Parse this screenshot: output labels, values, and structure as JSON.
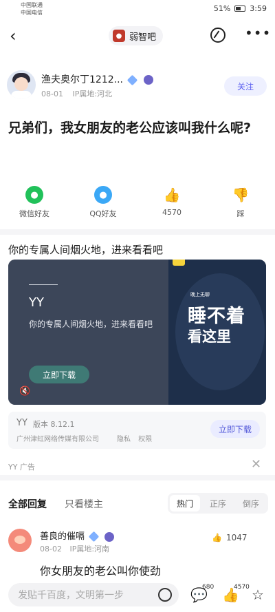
{
  "status_bar": {
    "carrier1": "中国联通",
    "carrier2": "中国电信",
    "battery": "51%",
    "time": "3:59"
  },
  "nav": {
    "forum_name": "弱智吧"
  },
  "author": {
    "name": "渔夫奥尔丁1212...",
    "date": "08-01",
    "ip": "IP属地:河北",
    "follow_label": "关注"
  },
  "post": {
    "title": "兄弟们，我女朋友的老公应该叫我什么呢?"
  },
  "share": {
    "wechat": "微信好友",
    "qq": "QQ好友",
    "like_count": "4570",
    "dislike": "踩"
  },
  "ad": {
    "headline": "你的专属人间烟火地，进来看看吧",
    "brand": "YY",
    "description": "你的专属人间烟火地，进来看看吧",
    "download": "立即下载",
    "right_small": "晚上无聊",
    "right_big1": "睡不着",
    "right_big2": "看这里",
    "info_brand": "YY",
    "version": "版本 8.12.1",
    "company": "广州津虹网络传媒有限公司",
    "privacy": "隐私",
    "permission": "权限",
    "info_download": "立即下载",
    "label": "YY  广告"
  },
  "replies": {
    "tab_all": "全部回复",
    "tab_op": "只看楼主",
    "sort_hot": "热门",
    "sort_asc": "正序",
    "sort_desc": "倒序"
  },
  "comment": {
    "name": "善良的催嗝",
    "date": "08-02",
    "ip": "IP属地:河南",
    "likes": "1047",
    "text": "你女朋友的老公叫你使劲"
  },
  "bottom": {
    "placeholder": "发贴千百度，文明第一步",
    "comment_count": "680",
    "like_count": "4570"
  },
  "icons": [
    "back-icon",
    "edit-icon",
    "more-icon",
    "wechat-icon",
    "qq-icon",
    "thumbs-up-icon",
    "thumbs-down-icon",
    "mute-icon",
    "close-icon",
    "emoji-icon",
    "comment-icon",
    "like-icon",
    "star-icon"
  ]
}
